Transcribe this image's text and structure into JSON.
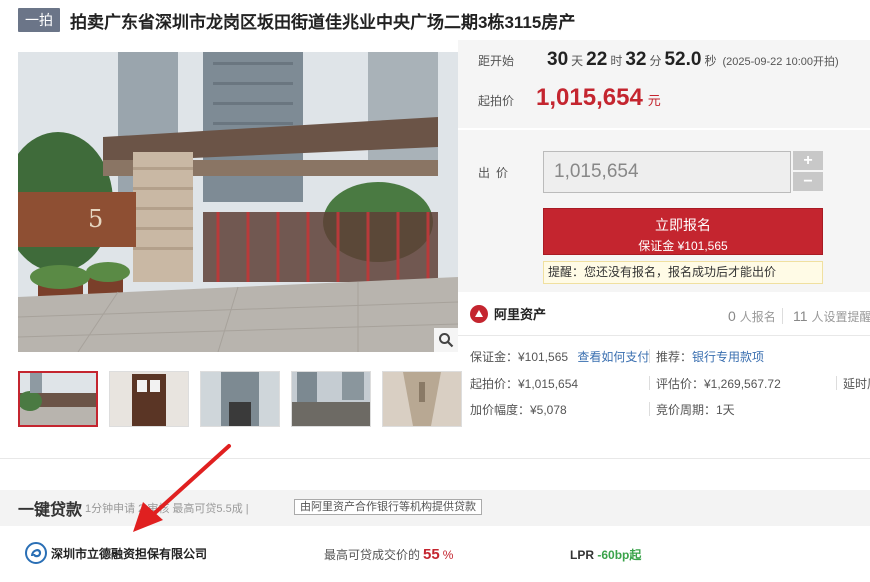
{
  "header": {
    "tag": "一拍",
    "title": "拍卖广东省深圳市龙岗区坂田街道佳兆业中央广场二期3栋3115房产"
  },
  "countdown": {
    "label": "距开始",
    "days": "30",
    "days_unit": "天",
    "hours": "22",
    "hours_unit": "时",
    "minutes": "32",
    "minutes_unit": "分",
    "seconds": "52.0",
    "seconds_unit": "秒",
    "start_time": "(2025-09-22 10:00开拍)"
  },
  "start_price": {
    "label": "起拍价",
    "value": "1,015,654",
    "unit": "元"
  },
  "bid": {
    "label": "出价",
    "placeholder": "1,015,654",
    "plus": "+",
    "minus": "−"
  },
  "signup": {
    "label": "立即报名",
    "deposit": "保证金 ¥101,565"
  },
  "notice": "提醒：您还没有报名，报名成功后才能出价",
  "platform": {
    "name": "阿里资产",
    "registered_count": "0",
    "registered_label": "人报名",
    "reminder_count": "11",
    "reminder_label": "人设置提醒"
  },
  "info": {
    "deposit_label": "保证金：¥101,565",
    "deposit_link": "查看如何支付",
    "recommend_label": "推荐：",
    "recommend_link": "银行专用款项",
    "start_price": "起拍价：¥1,015,654",
    "assessed_price": "评估价：¥1,269,567.72",
    "delay": "延时周",
    "increment": "加价幅度：¥5,078",
    "bid_cycle": "竞价周期：1天"
  },
  "loan": {
    "title": "一键贷款",
    "subtitle": "1分钟申请 2   审核 最高可贷5.5成 |",
    "tag": "由阿里资产合作银行等机构提供贷款",
    "company": "深圳市立德融资担保有限公司",
    "max_label": "最高可贷成交价的",
    "max_value": "55",
    "max_unit": "%",
    "lpr_label": "LPR",
    "lpr_value": "-60bp起"
  },
  "colors": {
    "accent": "#c4252f",
    "link": "#3a6fb0",
    "tag_bg": "#6b7588",
    "green": "#3aa34a"
  }
}
